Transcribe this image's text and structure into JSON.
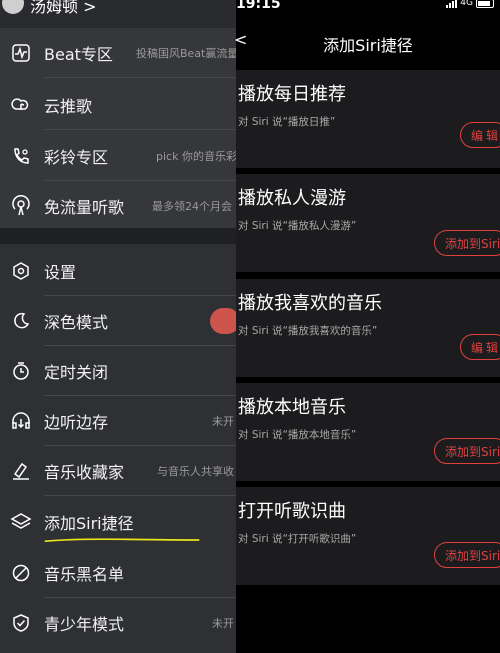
{
  "drawer": {
    "username": "汤姆顿 >",
    "group1": [
      {
        "label": "Beat专区",
        "sub": "投稿国风Beat赢流量",
        "icon": "beat-wave-icon"
      },
      {
        "label": "云推歌",
        "sub": "",
        "icon": "cloud-music-icon"
      },
      {
        "label": "彩铃专区",
        "sub": "pick 你的音乐彩",
        "icon": "ringtone-icon"
      },
      {
        "label": "免流量听歌",
        "sub": "最多领24个月会",
        "icon": "free-data-icon"
      }
    ],
    "group2": [
      {
        "label": "设置",
        "sub": "",
        "icon": "settings-icon"
      },
      {
        "label": "深色模式",
        "sub": "",
        "icon": "moon-icon"
      },
      {
        "label": "定时关闭",
        "sub": "",
        "icon": "timer-icon"
      },
      {
        "label": "边听边存",
        "sub": "未开",
        "icon": "listen-save-icon"
      },
      {
        "label": "音乐收藏家",
        "sub": "与音乐人共享收",
        "icon": "collector-icon"
      },
      {
        "label": "添加Siri捷径",
        "sub": "",
        "icon": "layers-icon"
      },
      {
        "label": "音乐黑名单",
        "sub": "",
        "icon": "blacklist-icon"
      },
      {
        "label": "青少年模式",
        "sub": "未开",
        "icon": "shield-check-icon"
      }
    ]
  },
  "status": {
    "time": "19:15",
    "network": "4G"
  },
  "navbar": {
    "back": "<",
    "title": "添加Siri捷径"
  },
  "shortcuts": [
    {
      "name": "播放每日推荐",
      "hint": "对 Siri 说“播放日推”",
      "button": "编辑",
      "kind": "edit"
    },
    {
      "name": "播放私人漫游",
      "hint": "对 Siri 说“播放私人漫游”",
      "button": "添加到Siri",
      "kind": "add"
    },
    {
      "name": "播放我喜欢的音乐",
      "hint": "对 Siri 说“播放我喜欢的音乐”",
      "button": "编辑",
      "kind": "edit"
    },
    {
      "name": "播放本地音乐",
      "hint": "对 Siri 说“播放本地音乐”",
      "button": "添加到Siri",
      "kind": "add"
    },
    {
      "name": "打开听歌识曲",
      "hint": "对 Siri 说“打开听歌识曲”",
      "button": "添加到Siri",
      "kind": "add"
    }
  ],
  "colors": {
    "accent": "#e0403e",
    "highlight_underline": "#e6e61e"
  }
}
